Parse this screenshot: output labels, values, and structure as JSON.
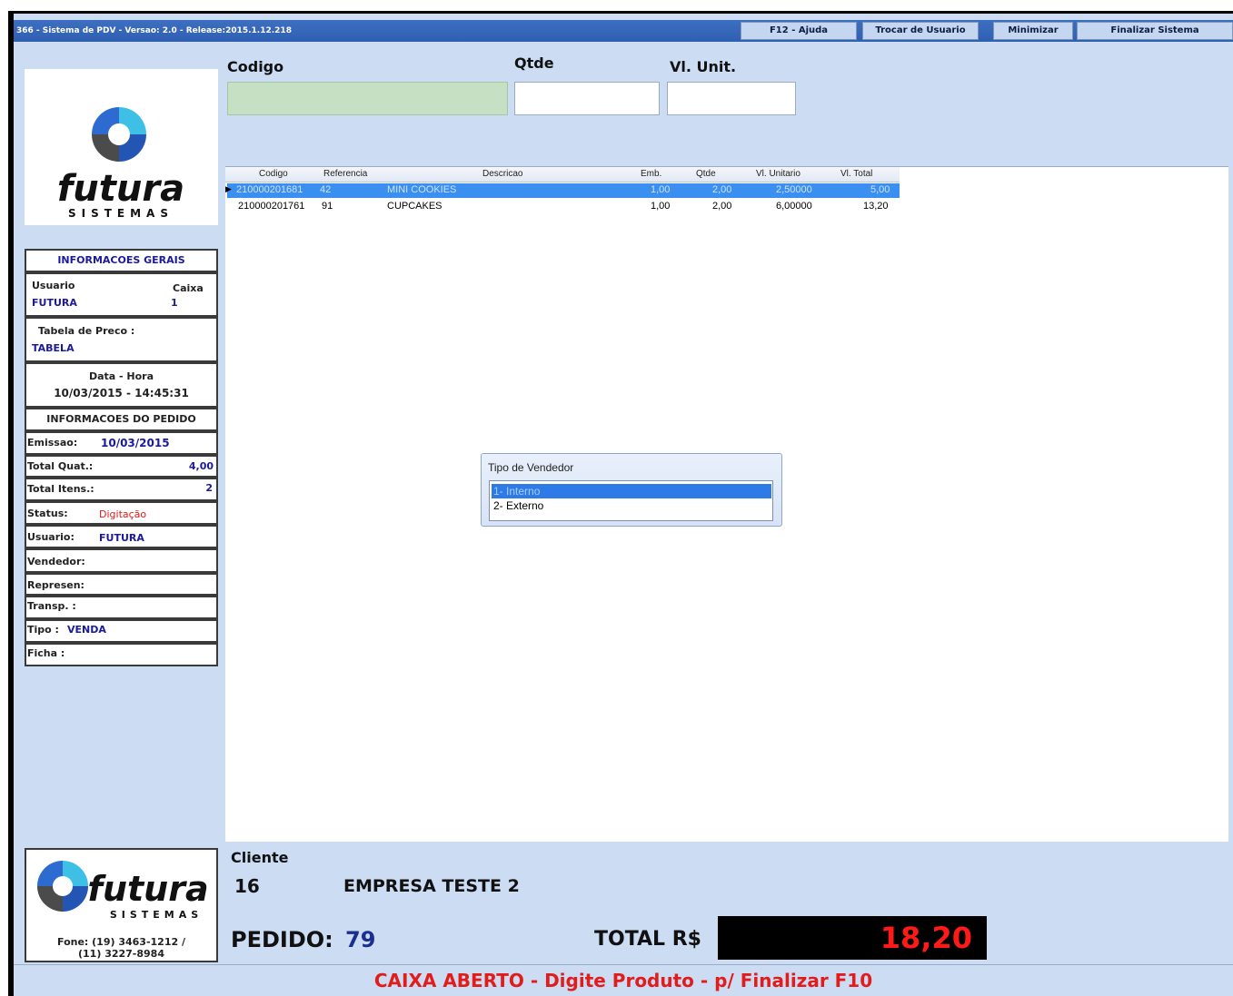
{
  "titlebar": {
    "title": "366 - Sistema de PDV - Versao: 2.0 - Release:2015.1.12.218",
    "buttons": [
      "F12 - Ajuda",
      "Trocar de Usuario",
      "Minimizar",
      "Finalizar Sistema"
    ]
  },
  "logo": {
    "brand": "futura",
    "sub": "SISTEMAS"
  },
  "info": {
    "header_gerais": "INFORMACOES GERAIS",
    "usuario_label": "Usuario",
    "usuario_value": "FUTURA",
    "caixa_label": "Caixa",
    "caixa_value": "1",
    "tabela_label": "Tabela de Preco :",
    "tabela_value": "TABELA",
    "datahora_label": "Data - Hora",
    "datahora_value": "10/03/2015 - 14:45:31",
    "header_pedido": "INFORMACOES DO PEDIDO",
    "emissao_label": "Emissao:",
    "emissao_value": "10/03/2015",
    "totalquat_label": "Total Quat.:",
    "totalquat_value": "4,00",
    "totalitens_label": "Total Itens.:",
    "totalitens_value": "2",
    "status_label": "Status:",
    "status_value": "Digitação",
    "usuario2_label": "Usuario:",
    "usuario2_value": "FUTURA",
    "vendedor_label": "Vendedor:",
    "represen_label": "Represen:",
    "transp_label": "Transp. :",
    "tipo_label": "Tipo :",
    "tipo_value": "VENDA",
    "ficha_label": "Ficha :"
  },
  "bottom_logo": {
    "phone1": "Fone: (19) 3463-1212 /",
    "phone2": "(11) 3227-8984"
  },
  "entry": {
    "codigo_label": "Codigo",
    "qtde_label": "Qtde",
    "vlunit_label": "Vl. Unit."
  },
  "grid": {
    "headers": [
      "Codigo",
      "Referencia",
      "Descricao",
      "Emb.",
      "Qtde",
      "Vl. Unitario",
      "Vl. Total"
    ],
    "rows": [
      {
        "codigo": "210000201681",
        "referencia": "42",
        "descricao": "MINI COOKIES",
        "emb": "1,00",
        "qtde": "2,00",
        "vlunit": "2,50000",
        "vltotal": "5,00"
      },
      {
        "codigo": "210000201761",
        "referencia": "91",
        "descricao": "CUPCAKES",
        "emb": "1,00",
        "qtde": "2,00",
        "vlunit": "6,00000",
        "vltotal": "13,20"
      }
    ]
  },
  "dialog": {
    "title": "Tipo de Vendedor",
    "options": [
      "1- Interno",
      "2- Externo"
    ]
  },
  "cliente": {
    "label": "Cliente",
    "id": "16",
    "name": "EMPRESA TESTE 2"
  },
  "pedido": {
    "label": "PEDIDO:",
    "number": "79"
  },
  "total": {
    "label": "TOTAL R$",
    "value": "18,20"
  },
  "status_bar": "CAIXA ABERTO - Digite Produto - p/ Finalizar F10",
  "colors": {
    "panel": "#cbdcf3",
    "accent": "#2e7be8",
    "alert": "#e21b1b"
  }
}
